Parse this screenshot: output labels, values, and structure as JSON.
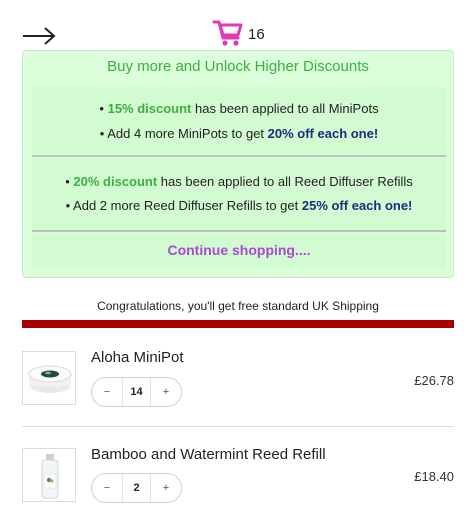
{
  "header": {
    "back_icon": "arrow-right-icon",
    "cart_icon": "shopping-cart-icon",
    "cart_count": "16",
    "cart_color": "#e03ab8"
  },
  "discounts": {
    "title": "Buy more and Unlock Higher Discounts",
    "tiers": [
      {
        "line1": {
          "bullet": "• ",
          "highlight": "15% discount",
          "rest": " has been applied to all MiniPots"
        },
        "line2": {
          "lead": "• Add 4 more MiniPots to get ",
          "highlight": "20% off each one!"
        }
      },
      {
        "line1": {
          "bullet": "• ",
          "highlight": "20% discount",
          "rest": " has been applied to all Reed Diffuser Refills"
        },
        "line2": {
          "lead": "• Add 2 more Reed Diffuser Refills to get ",
          "highlight": "25% off each one!"
        }
      }
    ],
    "continue_label": "Continue shopping....",
    "colors": {
      "green": "#3fae3f",
      "navy": "#1a2c7a",
      "purple": "#a64ccf",
      "box_bg": "#dbffdb"
    }
  },
  "shipping": {
    "message": "Congratulations, you'll get free standard UK Shipping",
    "progress": 1.0,
    "bar_color": "#a60000"
  },
  "items": [
    {
      "name": "Aloha MiniPot",
      "quantity": "14",
      "price": "£26.78",
      "minus": "−",
      "plus": "+"
    },
    {
      "name": "Bamboo and Watermint Reed Refill",
      "quantity": "2",
      "price": "£18.40",
      "minus": "−",
      "plus": "+"
    }
  ]
}
